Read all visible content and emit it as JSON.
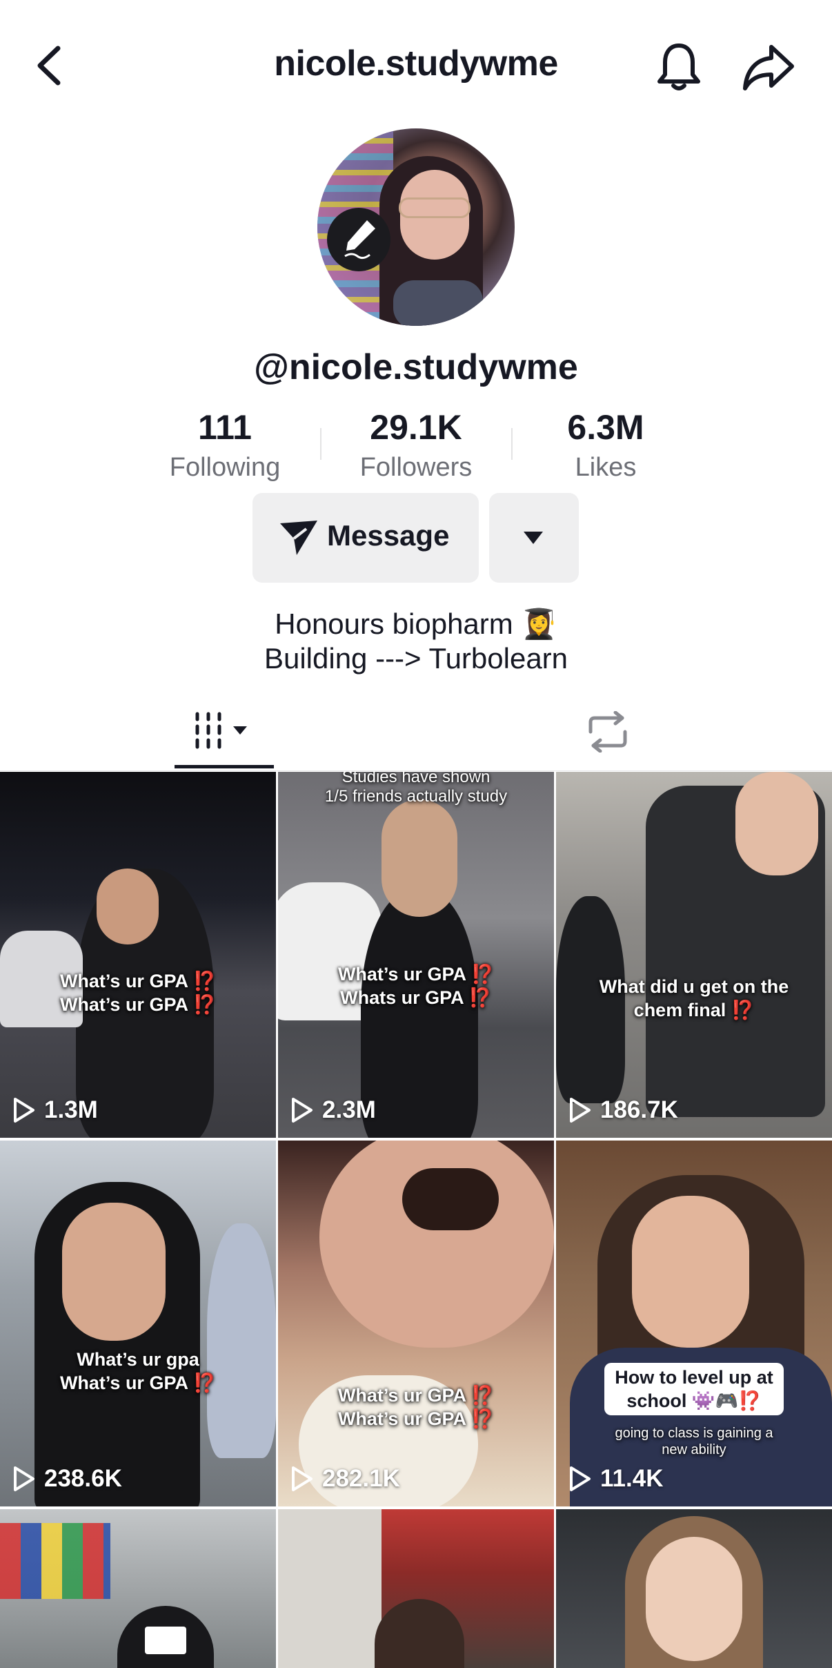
{
  "header": {
    "username": "nicole.studywme"
  },
  "profile": {
    "handle": "@nicole.studywme",
    "stats": [
      {
        "value": "111",
        "label": "Following"
      },
      {
        "value": "29.1K",
        "label": "Followers"
      },
      {
        "value": "6.3M",
        "label": "Likes"
      }
    ],
    "message_label": "Message",
    "bio_line1": "Honours biopharm 👩‍🎓",
    "bio_line2": "Building ---> Turbolearn"
  },
  "videos": [
    {
      "caption_top": "",
      "caption": "What’s ur GPA ⁉️\nWhat’s ur GPA ⁉️",
      "views": "1.3M"
    },
    {
      "caption_top": "Studies have shown\n1/5 friends actually study",
      "caption": "What’s ur GPA ⁉️\nWhats ur GPA ⁉️",
      "views": "2.3M"
    },
    {
      "caption_top": "",
      "caption": "What did u get on the\nchem final ⁉️",
      "views": "186.7K"
    },
    {
      "caption_top": "",
      "caption": "What’s ur gpa\nWhat’s ur GPA ⁉️",
      "views": "238.6K"
    },
    {
      "caption_top": "",
      "caption": "What’s ur GPA ⁉️\nWhat’s ur GPA ⁉️",
      "views": "282.1K"
    },
    {
      "caption_top": "",
      "caption": "How to level up at\nschool 👾🎮⁉️",
      "caption_sub": "going to class is gaining a\nnew ability",
      "views": "11.4K"
    },
    {
      "caption_top": "",
      "caption": "",
      "views": ""
    },
    {
      "caption_top": "",
      "caption": "",
      "views": ""
    },
    {
      "caption_top": "",
      "caption": "",
      "views": ""
    }
  ],
  "icons": {
    "back": "chevron-left-icon",
    "bell": "bell-icon",
    "share": "share-arrow-icon",
    "send": "paper-plane-icon",
    "grid": "grid-icon",
    "repost": "repost-icon",
    "play": "play-icon"
  },
  "colors": {
    "text": "#161823",
    "secondary": "#6c6e75",
    "button_bg": "#efeff0",
    "warning_red": "#e8262b"
  }
}
